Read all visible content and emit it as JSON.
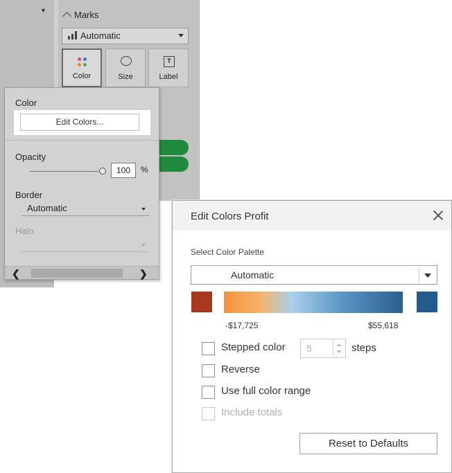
{
  "marks": {
    "header": "Marks",
    "mark_type": "Automatic",
    "buttons": {
      "color": "Color",
      "size": "Size",
      "label": "Label"
    },
    "dot_colors": [
      "#d94f4f",
      "#4a73c9",
      "#e08a2e",
      "#5aa05a"
    ]
  },
  "color_popover": {
    "color_heading": "Color",
    "edit_colors_button": "Edit Colors...",
    "opacity_heading": "Opacity",
    "opacity_value": "100",
    "opacity_unit": "%",
    "border_heading": "Border",
    "border_value": "Automatic",
    "halo_heading": "Halo"
  },
  "dialog": {
    "title": "Edit Colors Profit",
    "close_icon": "close-icon",
    "palette_label": "Select Color Palette",
    "palette_value": "Automatic",
    "range_min": "-$17,725",
    "range_max": "$55,618",
    "colors": {
      "low_swatch": "#a8381e",
      "high_swatch": "#245a8e",
      "gradient_stops": [
        "#f5923a",
        "#f7b26a",
        "#a9d0ea",
        "#5b97c7",
        "#2a5f8f"
      ]
    },
    "options": {
      "stepped_color": "Stepped color",
      "steps_value": "5",
      "steps_suffix": "steps",
      "reverse": "Reverse",
      "full_range": "Use full color range",
      "include_totals": "Include totals"
    },
    "reset_button": "Reset to Defaults"
  }
}
